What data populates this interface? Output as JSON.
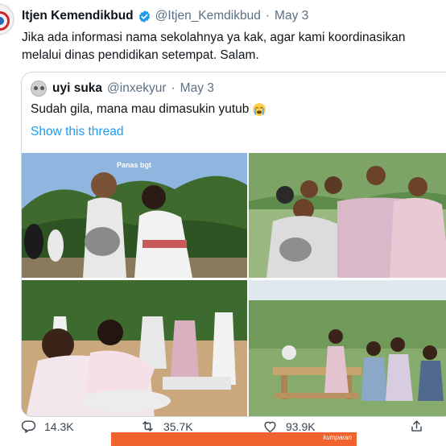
{
  "tweet": {
    "author_name": "Itjen Kemendikbud",
    "handle": "@Itjen_Kemdikbud",
    "separator": "·",
    "date": "May 3",
    "text": "Jika ada informasi nama sekolahnya ya kak, agar kami koordinasikan melalui dinas pendidikan setempat. Salam."
  },
  "quote": {
    "author_name": "uyi suka",
    "handle": "@inxekyur",
    "separator": "·",
    "date": "May 3",
    "text": "Sudah gila, mana mau dimasukin yutub",
    "show_thread": "Show this thread",
    "media_watermark": "Panas bgt"
  },
  "actions": {
    "reply_count": "14.3K",
    "retweet_count": "35.7K",
    "like_count": "93.9K"
  },
  "brand": {
    "label": "kumparan",
    "color": "#f0622e"
  },
  "colors": {
    "link": "#1d9bf0",
    "muted": "#5b7083",
    "verified": "#1d9bf0"
  },
  "icons": {
    "verified": "verified-badge-icon",
    "emoji": "crying-face-icon",
    "reply": "reply-icon",
    "retweet": "retweet-icon",
    "like": "heart-icon",
    "share": "share-icon"
  }
}
